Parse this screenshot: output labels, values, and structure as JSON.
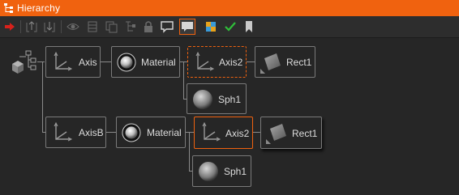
{
  "window": {
    "title": "Hierarchy",
    "accent": "#f0620f"
  },
  "toolbar": {
    "buttons": [
      {
        "icon": "red-arrow-icon",
        "state": "enabled"
      },
      {
        "icon": "move-up-icon",
        "state": "disabled"
      },
      {
        "icon": "move-down-icon",
        "state": "disabled"
      },
      {
        "icon": "eye-icon",
        "state": "disabled"
      },
      {
        "icon": "frame-icon",
        "state": "disabled"
      },
      {
        "icon": "copy-icon",
        "state": "disabled"
      },
      {
        "icon": "tree-icon",
        "state": "disabled"
      },
      {
        "icon": "lock-icon",
        "state": "disabled"
      },
      {
        "icon": "comment-icon",
        "state": "enabled"
      },
      {
        "icon": "comment-filled-icon",
        "state": "active"
      },
      {
        "icon": "color-grid-icon",
        "state": "enabled"
      },
      {
        "icon": "check-icon",
        "state": "enabled"
      },
      {
        "icon": "bookmark-icon",
        "state": "enabled"
      }
    ]
  },
  "tree": {
    "root": {
      "icon": "scene-root-icon"
    },
    "row1": {
      "axis": "Axis",
      "material": "Material",
      "axis2": "Axis2",
      "rect": "Rect1",
      "sph": "Sph1"
    },
    "row2": {
      "axis": "AxisB",
      "material": "Material",
      "axis2": "Axis2",
      "rect": "Rect1",
      "sph": "Sph1"
    }
  }
}
